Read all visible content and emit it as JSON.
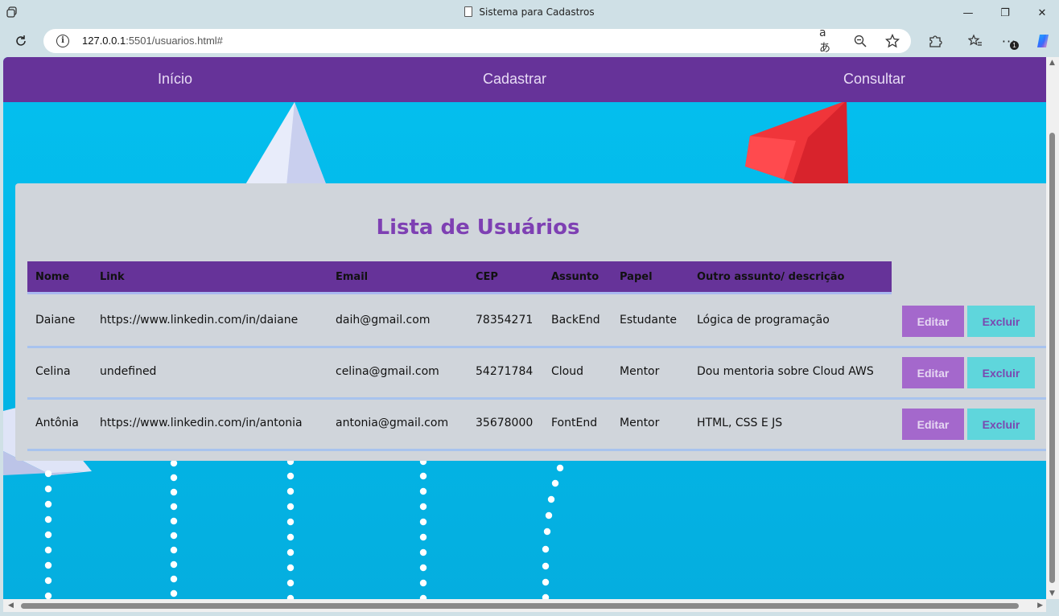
{
  "window": {
    "title": "Sistema para Cadastros",
    "controls": {
      "minimize": "—",
      "restore": "❐",
      "close": "✕"
    }
  },
  "browser": {
    "url_host": "127.0.0.1",
    "url_rest": ":5501/usuarios.html#",
    "read_aloud_icon": "aあ",
    "notification_count": "1"
  },
  "nav": {
    "items": [
      {
        "label": "Início"
      },
      {
        "label": "Cadastrar"
      },
      {
        "label": "Consultar"
      }
    ],
    "background": "#663399"
  },
  "main": {
    "title": "Lista de Usuários",
    "columns": [
      "Nome",
      "Link",
      "Email",
      "CEP",
      "Assunto",
      "Papel",
      "Outro assunto/ descrição"
    ],
    "rows": [
      {
        "nome": "Daiane",
        "link": "https://www.linkedin.com/in/daiane",
        "email": "daih@gmail.com",
        "cep": "78354271",
        "assunto": "BackEnd",
        "papel": "Estudante",
        "descricao": "Lógica de programação"
      },
      {
        "nome": "Celina",
        "link": "undefined",
        "email": "celina@gmail.com",
        "cep": "54271784",
        "assunto": "Cloud",
        "papel": "Mentor",
        "descricao": "Dou mentoria sobre Cloud AWS"
      },
      {
        "nome": "Antônia",
        "link": "https://www.linkedin.com/in/antonia",
        "email": "antonia@gmail.com",
        "cep": "35678000",
        "assunto": "FontEnd",
        "papel": "Mentor",
        "descricao": "HTML, CSS E JS"
      }
    ],
    "edit_label": "Editar",
    "delete_label": "Excluir",
    "colors": {
      "title": "#7e40b3",
      "edit_button": "#a468cc",
      "delete_button": "#5fd6dc"
    }
  }
}
